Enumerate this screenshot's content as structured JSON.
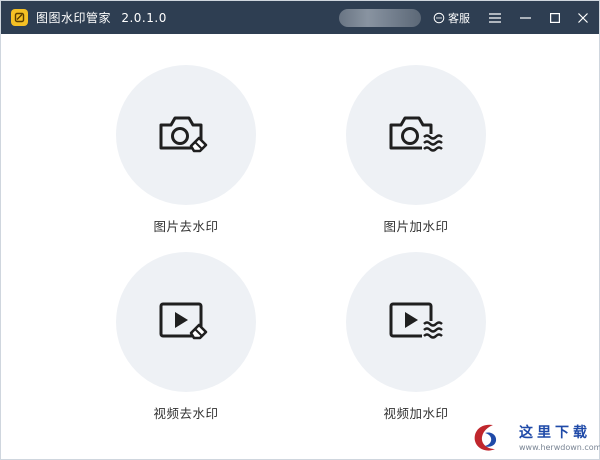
{
  "window": {
    "title": "图图水印管家",
    "version": "2.0.1.0",
    "support_label": "客服",
    "controls": [
      "menu-icon",
      "minimize-icon",
      "maximize-icon",
      "close-icon"
    ]
  },
  "tiles": [
    {
      "label": "图片去水印",
      "icon": "camera-eraser-icon"
    },
    {
      "label": "图片加水印",
      "icon": "camera-waves-icon"
    },
    {
      "label": "视频去水印",
      "icon": "video-eraser-icon"
    },
    {
      "label": "视频加水印",
      "icon": "video-waves-icon"
    }
  ],
  "watermark": {
    "text": "这里下载",
    "url": "www.herwdown.com"
  },
  "colors": {
    "titlebar": "#2e3e52",
    "tile_background": "#eef1f5",
    "icon": "#1f1f1f",
    "logo": "#f5c024"
  }
}
